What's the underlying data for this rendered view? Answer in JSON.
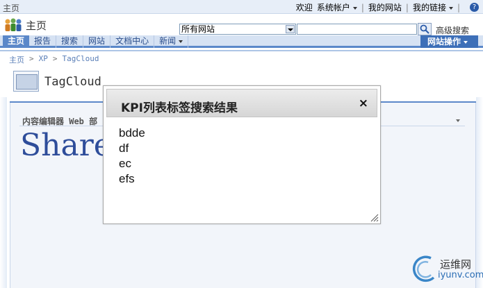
{
  "topbar": {
    "home": "主页",
    "welcome": "欢迎",
    "account": "系统帐户",
    "my_site": "我的网站",
    "my_links": "我的链接",
    "help_icon": "help-icon"
  },
  "header": {
    "site_title": "主页",
    "scope_value": "所有网站",
    "query_placeholder": "",
    "advanced_search": "高级搜索"
  },
  "nav": {
    "tabs": [
      {
        "label": "主页",
        "active": true
      },
      {
        "label": "报告"
      },
      {
        "label": "搜索"
      },
      {
        "label": "网站"
      },
      {
        "label": "文档中心"
      },
      {
        "label": "新闻"
      }
    ],
    "site_actions": "网站操作"
  },
  "breadcrumb": {
    "items": [
      "主页",
      "XP",
      "TagCloud"
    ]
  },
  "page": {
    "title": "TagCloud"
  },
  "webpart": {
    "title": "内容编辑器 Web 部",
    "content_text": "Share"
  },
  "modal": {
    "title": "KPI列表标签搜索结果",
    "close_label": "×",
    "results": [
      "bdde",
      "df",
      "ec",
      "efs"
    ]
  },
  "watermark": {
    "line1": "运维网",
    "line2": "iyunv.com"
  },
  "colors": {
    "nav_active": "#5b88c9",
    "site_actions_bg": "#3d6fb8",
    "big_text": "#2e4d9a"
  }
}
